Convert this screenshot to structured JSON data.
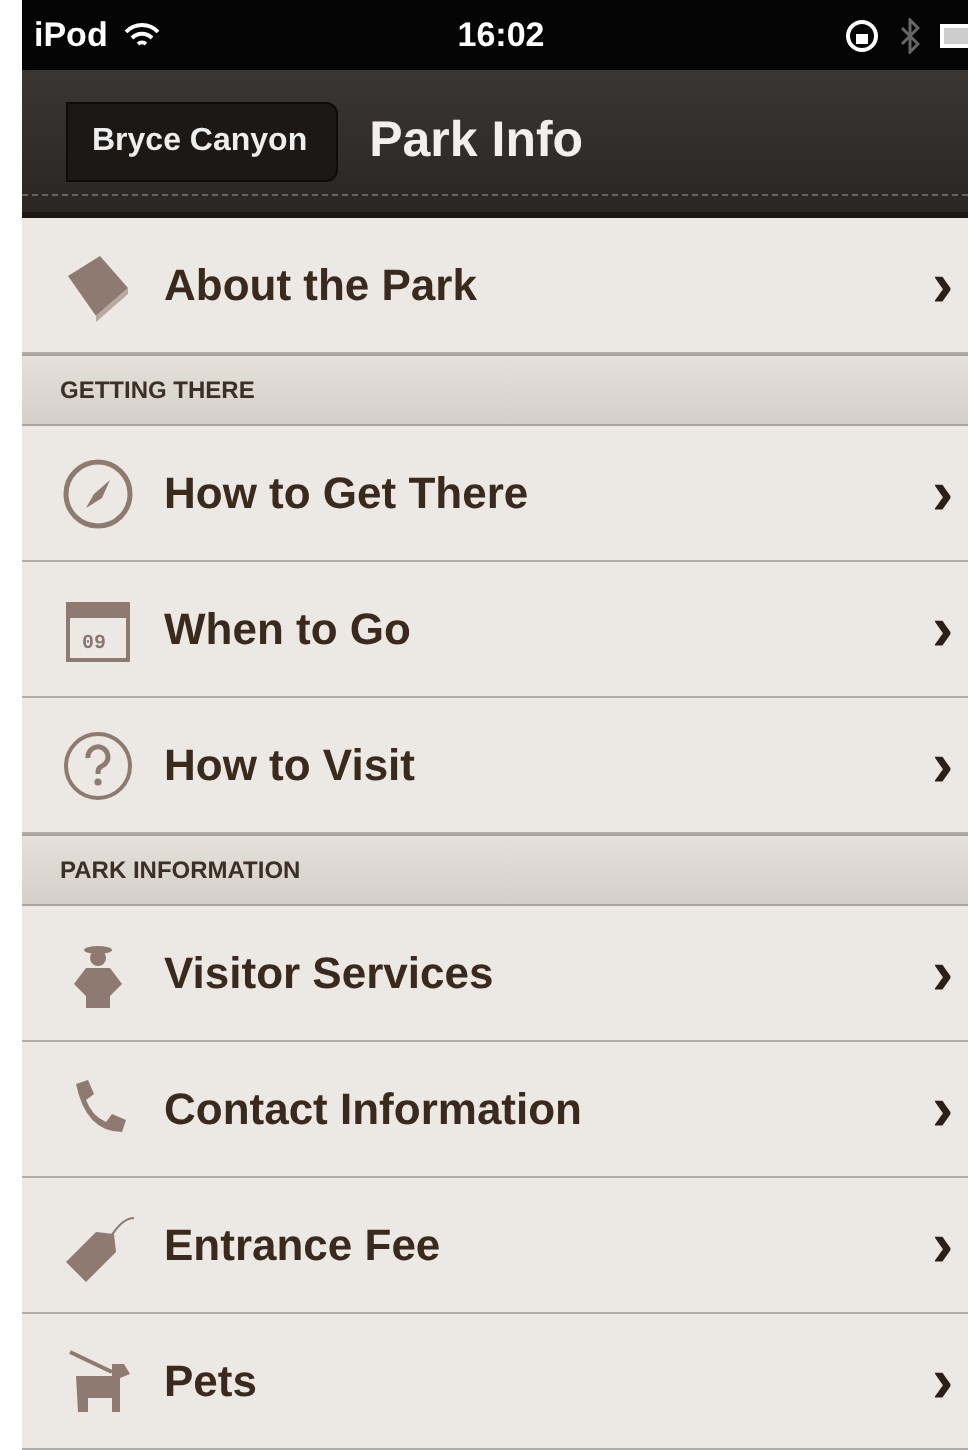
{
  "status_bar": {
    "device": "iPod",
    "time": "16:02"
  },
  "nav_bar": {
    "back": "Bryce Canyon",
    "title": "Park Info"
  },
  "sections": [
    {
      "items": [
        {
          "kind": "book",
          "label": "About the Park",
          "chevron": "›"
        }
      ]
    },
    {
      "header": "GETTING THERE",
      "items": [
        {
          "kind": "compass",
          "label": "How to Get There",
          "chevron": "›"
        },
        {
          "kind": "calendar",
          "icon_text": "09",
          "label": "When to Go",
          "chevron": "›"
        },
        {
          "kind": "question",
          "label": "How to Visit",
          "chevron": "›"
        }
      ]
    },
    {
      "header": "PARK INFORMATION",
      "items": [
        {
          "kind": "ranger",
          "label": "Visitor Services",
          "chevron": "›"
        },
        {
          "kind": "phone",
          "label": "Contact Information",
          "chevron": "›"
        },
        {
          "kind": "tag",
          "label": "Entrance Fee",
          "chevron": "›"
        },
        {
          "kind": "dog",
          "label": "Pets",
          "chevron": "›"
        }
      ]
    }
  ]
}
